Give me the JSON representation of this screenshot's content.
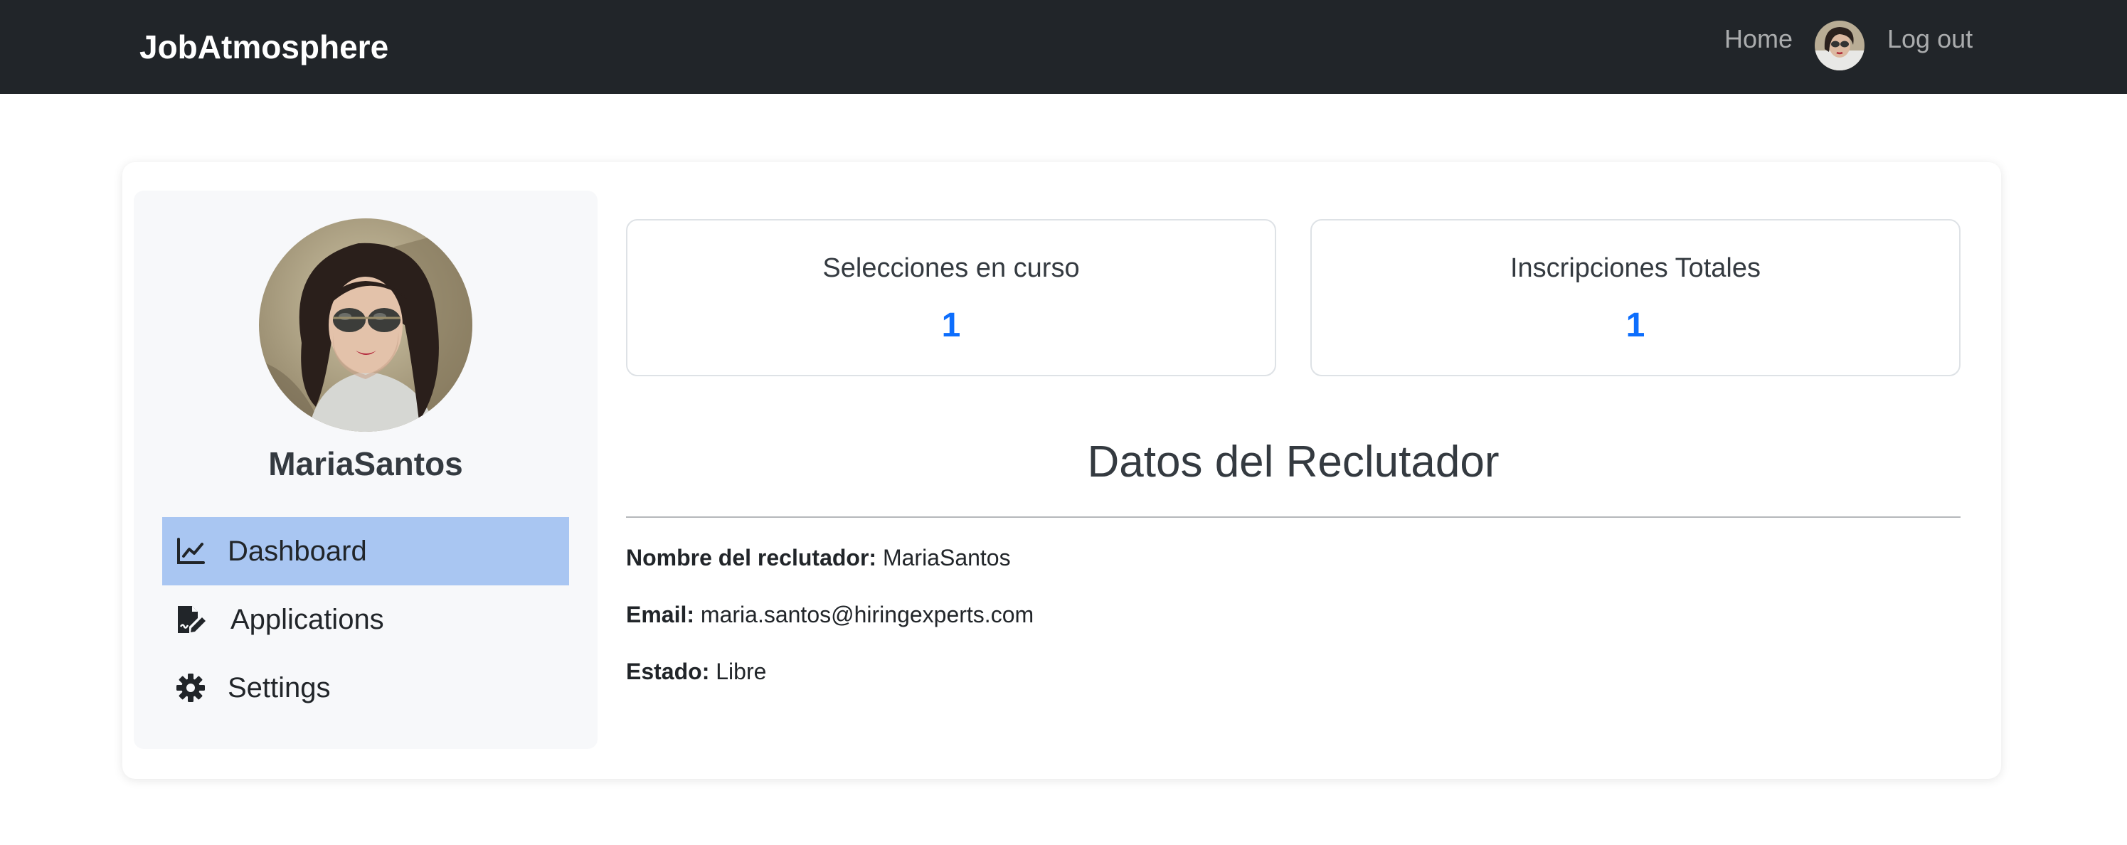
{
  "navbar": {
    "brand": "JobAtmosphere",
    "home_label": "Home",
    "logout_label": "Log out"
  },
  "sidebar": {
    "username": "MariaSantos",
    "items": [
      {
        "label": "Dashboard",
        "icon": "chart-line-icon",
        "active": true
      },
      {
        "label": "Applications",
        "icon": "file-signature-icon",
        "active": false
      },
      {
        "label": "Settings",
        "icon": "gear-icon",
        "active": false
      }
    ]
  },
  "stats": [
    {
      "title": "Selecciones en curso",
      "value": "1"
    },
    {
      "title": "Inscripciones Totales",
      "value": "1"
    }
  ],
  "recruiter": {
    "section_title": "Datos del Reclutador",
    "fields": [
      {
        "label": "Nombre del reclutador:",
        "value": "MariaSantos"
      },
      {
        "label": "Email:",
        "value": "maria.santos@hiringexperts.com"
      },
      {
        "label": "Estado:",
        "value": "Libre"
      }
    ]
  },
  "colors": {
    "navbar_bg": "#212529",
    "accent": "#0d6efd",
    "active_menu_bg": "#a9c6f2",
    "sidebar_bg": "#f7f8fa"
  }
}
